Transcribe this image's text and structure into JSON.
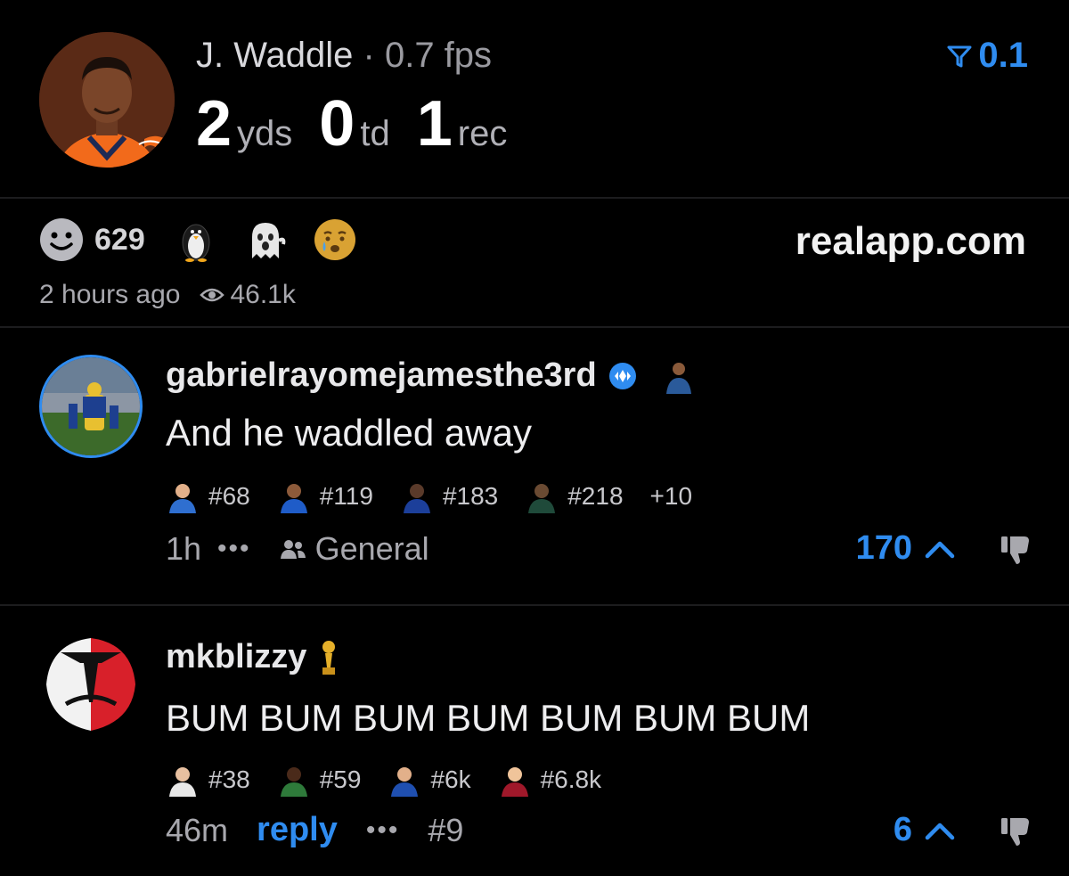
{
  "header": {
    "player_name": "J. Waddle",
    "separator": "·",
    "fps": "0.7 fps",
    "stats": [
      {
        "value": "2",
        "unit": "yds"
      },
      {
        "value": "0",
        "unit": "td"
      },
      {
        "value": "1",
        "unit": "rec"
      }
    ],
    "filter_value": "0.1",
    "filter_icon": "filter-icon",
    "accent": "#2f8cf0"
  },
  "post": {
    "reaction_count": "629",
    "reaction_icons": [
      "smile-icon",
      "penguin-icon",
      "ghost-icon",
      "crying-face-icon"
    ],
    "site": "realapp.com",
    "time": "2 hours ago",
    "views": "46.1k"
  },
  "comments": [
    {
      "username": "gabrielrayomejamesthe3rd",
      "text": "And he waddled away",
      "ranks": [
        "#68",
        "#119",
        "#183",
        "#218"
      ],
      "extra": "+10",
      "time": "1h",
      "dots": "•••",
      "channel": "General",
      "votes": "170"
    },
    {
      "username": "mkblizzy",
      "text": "BUM BUM BUM BUM BUM BUM BUM",
      "ranks": [
        "#38",
        "#59",
        "#6k",
        "#6.8k"
      ],
      "time": "46m",
      "reply": "reply",
      "dots": "•••",
      "number": "#9",
      "votes": "6"
    }
  ]
}
